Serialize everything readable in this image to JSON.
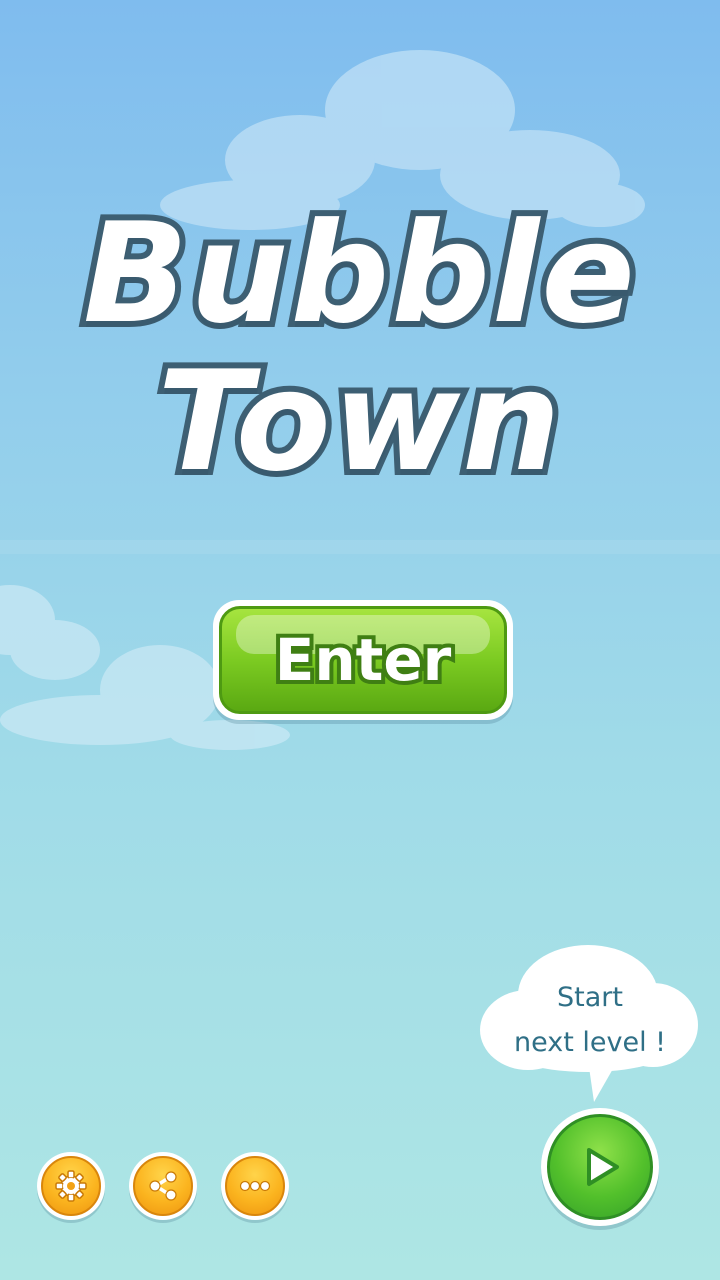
{
  "title": {
    "line1": "Bubble",
    "line2": "Town"
  },
  "enter_button": {
    "label": "Enter"
  },
  "hint_bubble": {
    "line1": "Start",
    "line2": "next level !"
  },
  "icons": {
    "settings": "gear-icon",
    "share": "share-icon",
    "more": "more-dots-icon",
    "play": "play-icon"
  },
  "colors": {
    "sky_top": "#7fbcee",
    "sky_bottom": "#aee6e4",
    "title_outline": "#3d5f73",
    "enter_green": "#7ccb22",
    "play_green": "#52c02b",
    "orange_buttons": "#fbb41f",
    "hint_text": "#2f6f86"
  }
}
